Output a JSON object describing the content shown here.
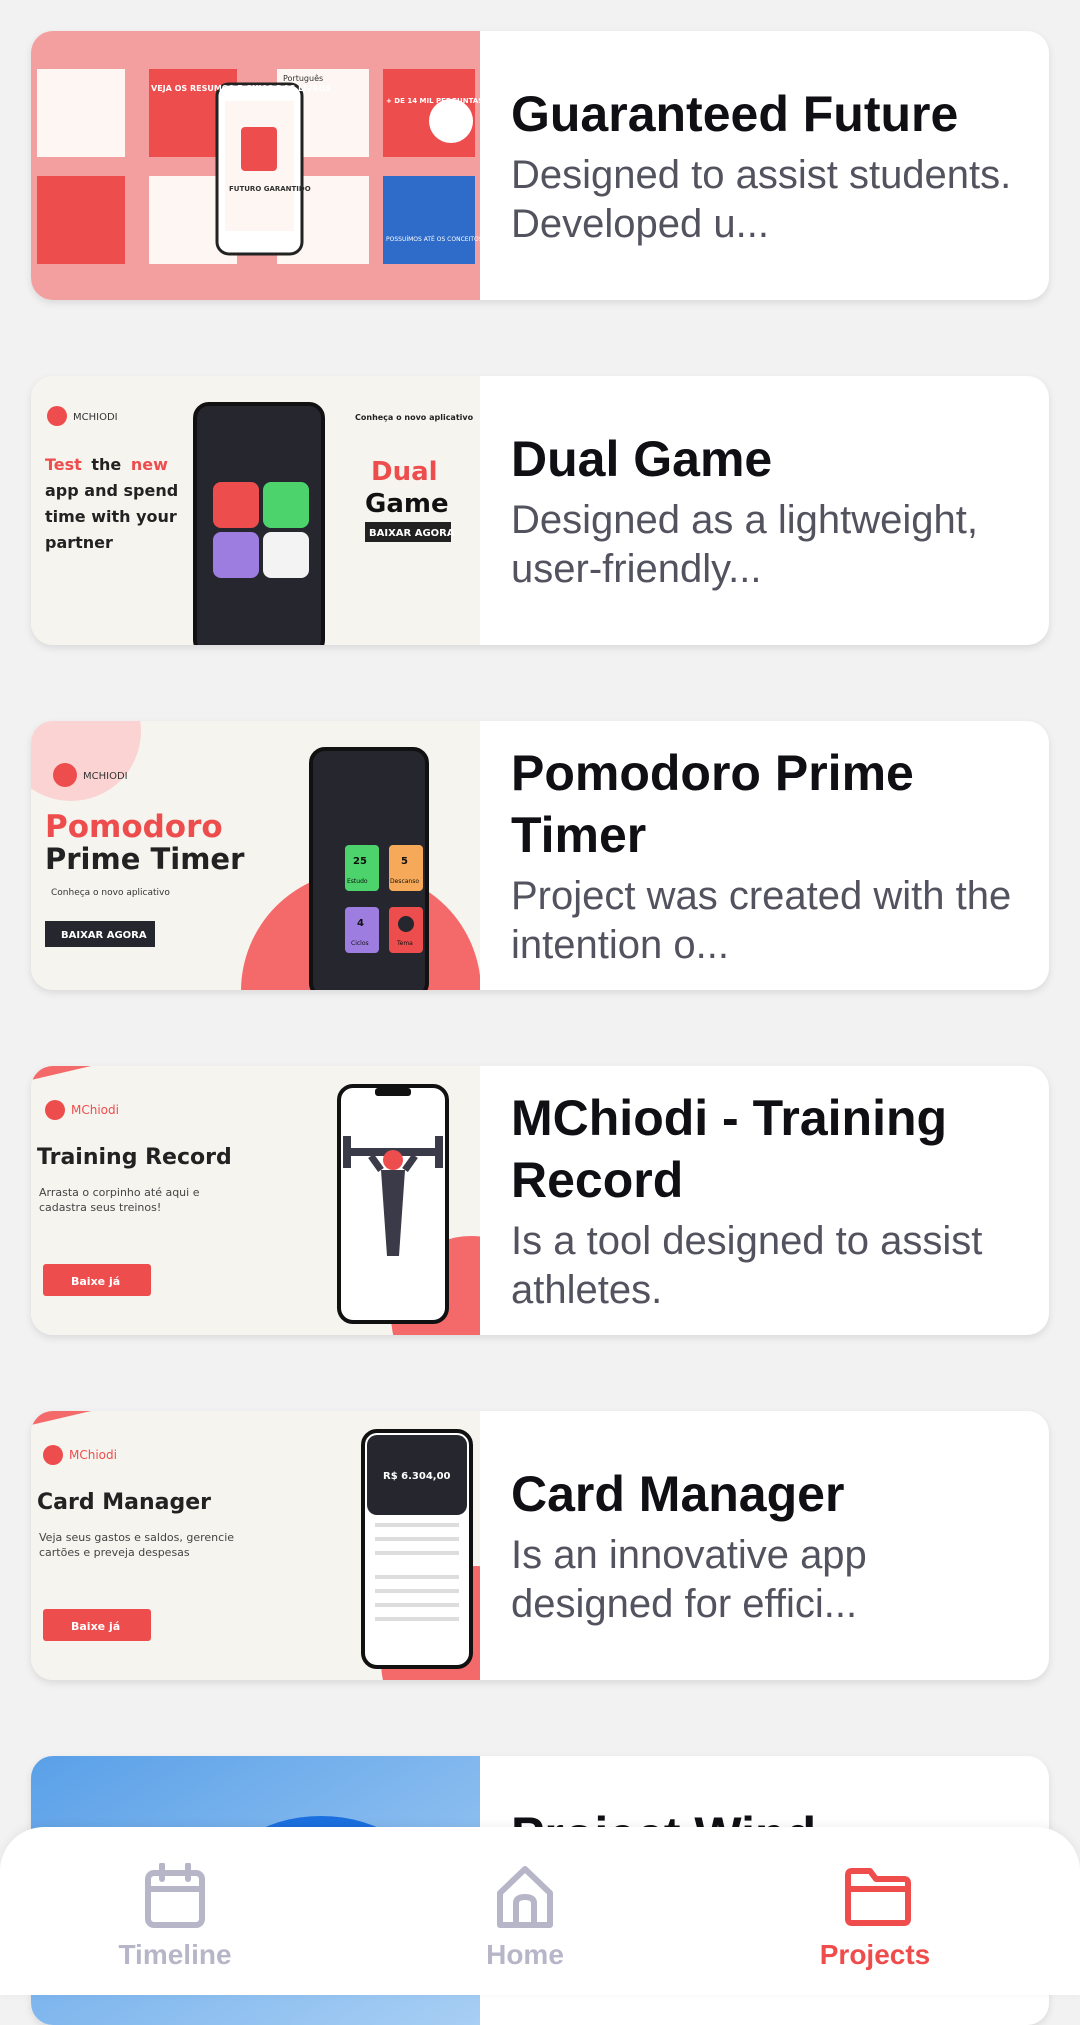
{
  "projects": [
    {
      "title": "Guaranteed Future",
      "description": "Designed to assist students. Developed u...",
      "thumb": {
        "tile_texts": [
          "VEJA OS RESUMOS E GUIAS DOS LIVROS",
          "Português",
          "+ DE 14 MIL PERGUNTAS",
          "POSSUÍMOS ATÉ OS CONCEITOS",
          "FUTURO GARANTIDO"
        ]
      }
    },
    {
      "title": "Dual Game",
      "description": "Designed as a lightweight, user-friendly...",
      "thumb": {
        "brand": "MCHIODI",
        "tagline_1": "Test",
        "tagline_2": "the",
        "tagline_3": "new",
        "tagline_line2": "app and spend",
        "tagline_line3": "time with your",
        "tagline_line4": "partner",
        "promo": "Conheça o novo aplicativo",
        "app_name_1": "Dual",
        "app_name_2": "Game",
        "cta": "BAIXAR AGORA"
      }
    },
    {
      "title": "Pomodoro Prime Timer",
      "description": "Project was created with the intention o...",
      "thumb": {
        "brand": "MCHIODI",
        "app_name_1": "Pomodoro",
        "app_name_2": "Prime Timer",
        "promo": "Conheça o novo aplicativo",
        "cta": "BAIXAR AGORA",
        "tiles": [
          {
            "num": "25",
            "label": "Estudo"
          },
          {
            "num": "5",
            "label": "Descanso"
          },
          {
            "num": "4",
            "label": "Ciclos"
          },
          {
            "num": "",
            "label": "Tema"
          }
        ]
      }
    },
    {
      "title": "MChiodi - Training Record",
      "description": "Is a tool designed to assist athletes.",
      "thumb": {
        "brand": "MChiodi",
        "app_name": "Training Record",
        "subtitle_1": "Arrasta o corpinho até aqui e",
        "subtitle_2": "cadastra seus treinos!",
        "cta": "Baixe já"
      }
    },
    {
      "title": "Card Manager",
      "description": "Is an innovative app designed for effici...",
      "thumb": {
        "brand": "MChiodi",
        "app_name": "Card Manager",
        "subtitle_1": "Veja seus gastos e saldos, gerencie",
        "subtitle_2": "cartões e preveja despesas",
        "cta": "Baixe já",
        "balance": "R$ 6.304,00"
      }
    },
    {
      "title": "Project Wind...",
      "description": ""
    }
  ],
  "nav": {
    "items": [
      {
        "label": "Timeline",
        "icon": "calendar-icon",
        "active": false
      },
      {
        "label": "Home",
        "icon": "home-icon",
        "active": false
      },
      {
        "label": "Projects",
        "icon": "folder-icon",
        "active": true
      }
    ]
  },
  "colors": {
    "accent": "#ef4c4c",
    "inactive": "#b7b6c8",
    "background": "#f2f2f3"
  }
}
